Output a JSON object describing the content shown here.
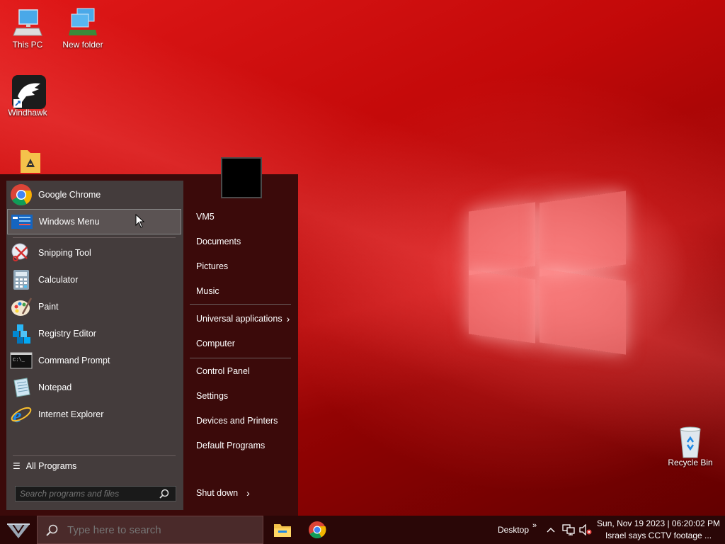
{
  "desktop": {
    "icons": [
      {
        "label": "This PC"
      },
      {
        "label": "New folder"
      },
      {
        "label": "Windhawk"
      },
      {
        "label": ""
      },
      {
        "label": "Recycle Bin"
      }
    ]
  },
  "start_menu": {
    "pinned": [
      {
        "label": "Google Chrome",
        "icon": "chrome-icon"
      },
      {
        "label": "Windows Menu",
        "icon": "windows-menu-icon"
      }
    ],
    "recent": [
      {
        "label": "Snipping Tool",
        "icon": "scissors-icon"
      },
      {
        "label": "Calculator",
        "icon": "calculator-icon"
      },
      {
        "label": "Paint",
        "icon": "palette-icon"
      },
      {
        "label": "Registry Editor",
        "icon": "registry-icon"
      },
      {
        "label": "Command Prompt",
        "icon": "terminal-icon"
      },
      {
        "label": "Notepad",
        "icon": "notepad-icon"
      },
      {
        "label": "Internet Explorer",
        "icon": "ie-icon"
      }
    ],
    "all_programs": "All Programs",
    "search_placeholder": "Search programs and files",
    "right_items": [
      {
        "label": "VM5"
      },
      {
        "label": "Documents"
      },
      {
        "label": "Pictures"
      },
      {
        "label": "Music"
      },
      {
        "label": "Universal applications",
        "has_submenu": true
      },
      {
        "label": "Computer"
      },
      {
        "label": "Control Panel"
      },
      {
        "label": "Settings"
      },
      {
        "label": "Devices and Printers"
      },
      {
        "label": "Default Programs"
      }
    ],
    "shutdown": "Shut down",
    "chevron": "›"
  },
  "taskbar": {
    "search_placeholder": "Type here to search",
    "desktop_label": "Desktop",
    "overflow": "»",
    "tray_arrow": "^",
    "clock_line1": "Sun, Nov 19 2023 | 06:20:02 PM",
    "clock_line2": "Israel says CCTV footage ..."
  },
  "colors": {
    "accent": "#c30909",
    "taskbar": "#2a0707",
    "menu_left": "#443c3c",
    "menu_right": "#3b0a0a"
  }
}
